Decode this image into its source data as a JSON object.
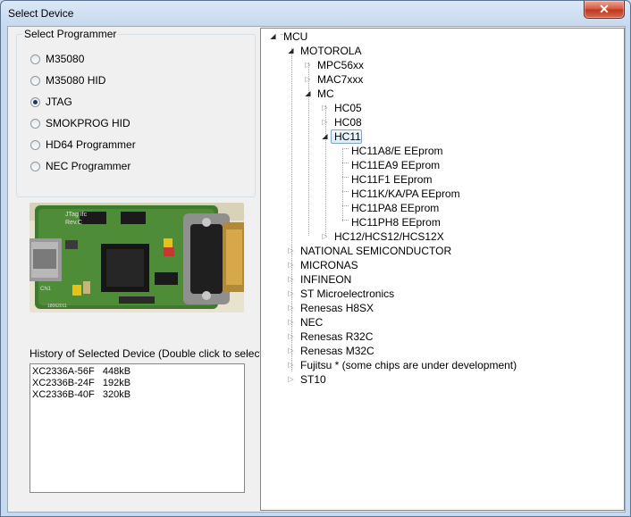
{
  "window": {
    "title": "Select Device",
    "close_label": "✕"
  },
  "programmer_group": {
    "title": "Select Programmer",
    "options": [
      "M35080",
      "M35080 HID",
      "JTAG",
      "SMOKPROG HID",
      "HD64 Programmer",
      "NEC Programmer"
    ],
    "selected": "JTAG"
  },
  "photo": {
    "caption": "JTag Ifc",
    "rev": "Rev.C",
    "ref": "CN1",
    "date": "18062011"
  },
  "history": {
    "label": "History of Selected Device (Double click to select)",
    "items": [
      "XC2336A-56F   448kB",
      "XC2336B-24F   192kB",
      "XC2336B-40F   320kB"
    ]
  },
  "tree": {
    "selected": "HC11",
    "nodes": [
      {
        "label": "MCU",
        "state": "expanded"
      },
      {
        "label": "MOTOROLA",
        "state": "expanded"
      },
      {
        "label": "MPC56xx",
        "state": "collapsed"
      },
      {
        "label": "MAC7xxx",
        "state": "collapsed"
      },
      {
        "label": "MC",
        "state": "expanded"
      },
      {
        "label": "HC05",
        "state": "collapsed"
      },
      {
        "label": "HC08",
        "state": "collapsed"
      },
      {
        "label": "HC11",
        "state": "expanded"
      },
      {
        "label": "HC11A8/E EEprom",
        "state": "leaf"
      },
      {
        "label": "HC11EA9 EEprom",
        "state": "leaf"
      },
      {
        "label": "HC11F1 EEprom",
        "state": "leaf"
      },
      {
        "label": "HC11K/KA/PA EEprom",
        "state": "leaf"
      },
      {
        "label": "HC11PA8 EEprom",
        "state": "leaf"
      },
      {
        "label": "HC11PH8 EEprom",
        "state": "leaf"
      },
      {
        "label": "HC12/HCS12/HCS12X",
        "state": "collapsed"
      },
      {
        "label": "NATIONAL SEMICONDUCTOR",
        "state": "collapsed"
      },
      {
        "label": "MICRONAS",
        "state": "collapsed"
      },
      {
        "label": "INFINEON",
        "state": "collapsed"
      },
      {
        "label": "ST Microelectronics",
        "state": "collapsed"
      },
      {
        "label": "Renesas H8SX",
        "state": "collapsed"
      },
      {
        "label": "NEC",
        "state": "collapsed"
      },
      {
        "label": "Renesas R32C",
        "state": "collapsed"
      },
      {
        "label": "Renesas M32C",
        "state": "collapsed"
      },
      {
        "label": "Fujitsu * (some chips are under development)",
        "state": "collapsed"
      },
      {
        "label": "ST10",
        "state": "collapsed"
      }
    ]
  }
}
